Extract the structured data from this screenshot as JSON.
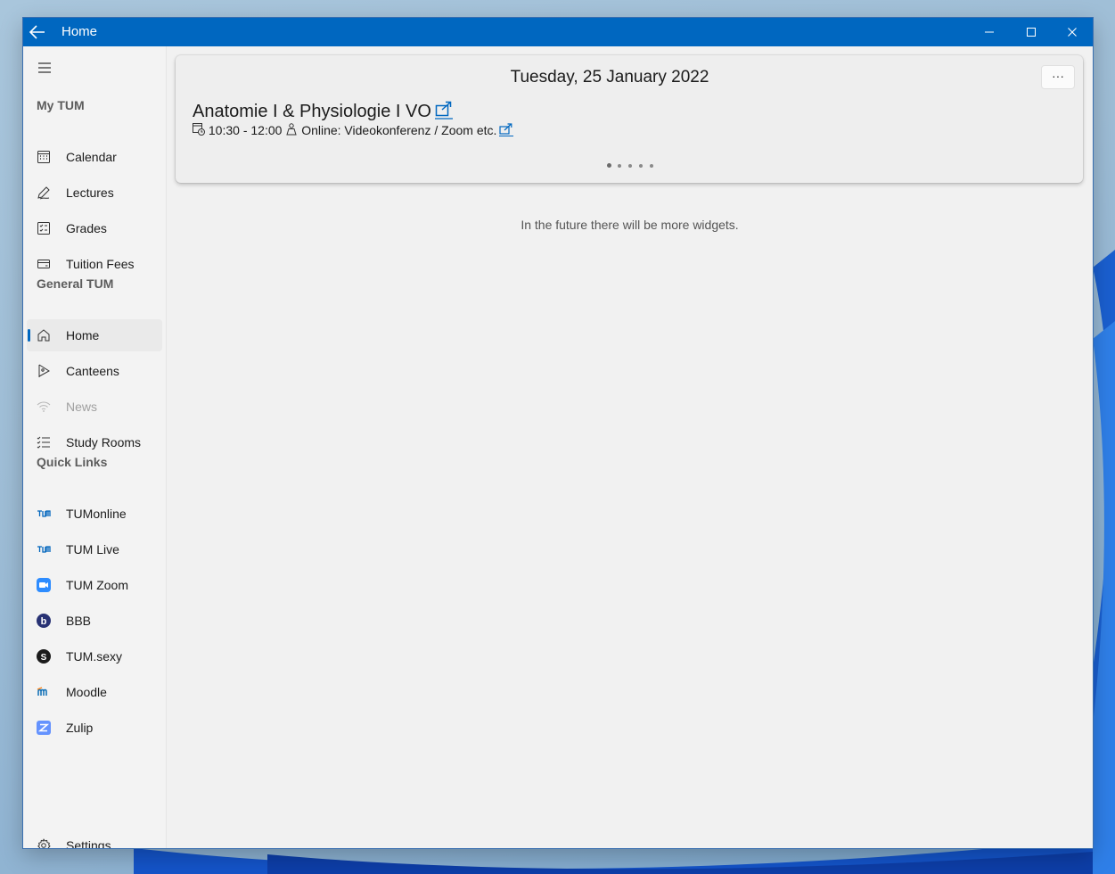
{
  "window": {
    "title": "Home"
  },
  "sidebar": {
    "sections": {
      "my_tum": "My TUM",
      "general_tum": "General TUM",
      "quick_links": "Quick Links"
    },
    "my_tum_items": [
      {
        "label": "Calendar",
        "icon": "calendar-icon"
      },
      {
        "label": "Lectures",
        "icon": "pen-icon"
      },
      {
        "label": "Grades",
        "icon": "grades-icon"
      },
      {
        "label": "Tuition Fees",
        "icon": "credit-card-icon"
      }
    ],
    "general_items": [
      {
        "label": "Home",
        "icon": "home-icon",
        "selected": true
      },
      {
        "label": "Canteens",
        "icon": "food-icon"
      },
      {
        "label": "News",
        "icon": "wifi-icon",
        "disabled": true
      },
      {
        "label": "Study Rooms",
        "icon": "checklist-icon"
      }
    ],
    "quick_links": [
      {
        "label": "TUMonline",
        "icon": "tum-logo-icon"
      },
      {
        "label": "TUM Live",
        "icon": "tum-logo-icon"
      },
      {
        "label": "TUM Zoom",
        "icon": "zoom-icon"
      },
      {
        "label": "BBB",
        "icon": "bbb-icon"
      },
      {
        "label": "TUM.sexy",
        "icon": "tum-sexy-icon"
      },
      {
        "label": "Moodle",
        "icon": "moodle-icon"
      },
      {
        "label": "Zulip",
        "icon": "zulip-icon"
      }
    ],
    "settings_label": "Settings"
  },
  "widget": {
    "date": "Tuesday, 25 January 2022",
    "more_label": "···",
    "lecture_title": "Anatomie I & Physiologie I VO",
    "time": "10:30 - 12:00",
    "location": "Online: Videokonferenz / Zoom etc.",
    "pager_count": 5,
    "pager_active": 1
  },
  "future_note": "In the future there will be more widgets.",
  "colors": {
    "accent": "#0067c0",
    "titlebar": "#0067c0"
  }
}
